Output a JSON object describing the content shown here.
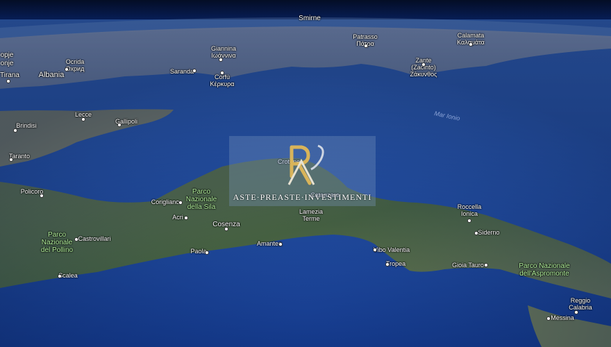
{
  "watermark": {
    "text": "ASTE·PREASTE·INVESTIMENTI",
    "brand_color": "#d9b45a"
  },
  "labels": {
    "smirne": "Smirne",
    "opje": "opje",
    "onje": "onje",
    "tirana": "Tirana",
    "albania": "Albania",
    "ocrida": "Ocrida\nОхрид",
    "giannina": "Giannina\nΙωάννινα",
    "saranda": "Saranda",
    "corfu": "Corfù\nΚέρκυρα",
    "patrasso": "Patrasso\nΠάτρα",
    "calamata": "Calamata\nΚαλαμάτα",
    "zante": "Zante\n(Zacinto)\nΖάκυνθος",
    "brindisi": "Brindisi",
    "lecce": "Lecce",
    "gallipoli": "Gallipoli",
    "taranto": "Taranto",
    "policoro": "Policoro",
    "corigliano": "Corigliano",
    "acri": "Acri",
    "cosenza": "Cosenza",
    "crotone": "Crotone",
    "catanzaro": "Catanzaro",
    "lamezia": "Lamezia\nTerme",
    "castrovillari": "Castrovillari",
    "paola": "Paola",
    "amantea": "Amantea",
    "scalea": "Scalea",
    "vibo": "Vibo Valentia",
    "tropea": "Tropea",
    "gioia": "Gioia Tauro",
    "roccella": "Roccella\nIonica",
    "siderno": "Siderno",
    "reggio": "Reggio\nCalabria",
    "messina": "Messina",
    "mar_ionio": "Mar Ionio",
    "park_sila": "Parco\nNazionale\ndella Sila",
    "park_pollino": "Parco\nNazionale\ndel Pollino",
    "park_aspromonte": "Parco Nazionale\ndell'Aspromonte"
  }
}
